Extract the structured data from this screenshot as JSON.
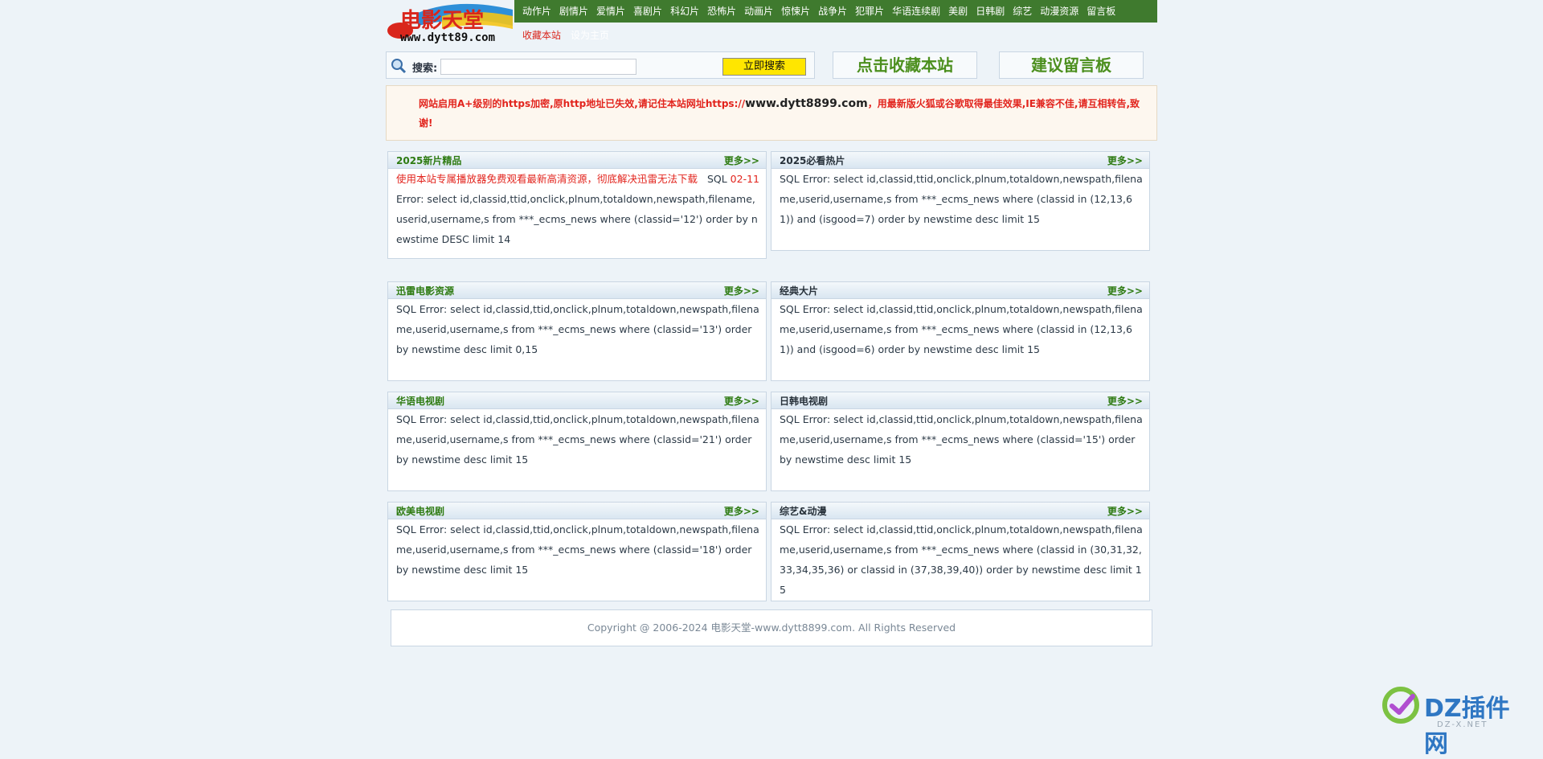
{
  "header": {
    "logo_text": "电影天堂",
    "logo_domain": "www.dytt89.com",
    "nav": [
      "动作片",
      "剧情片",
      "爱情片",
      "喜剧片",
      "科幻片",
      "恐怖片",
      "动画片",
      "惊悚片",
      "战争片",
      "犯罪片",
      "华语连续剧",
      "美剧",
      "日韩剧",
      "综艺",
      "动漫资源",
      "留言板"
    ],
    "sub_links": {
      "favorite": "收藏本站",
      "homepage": "设为主页"
    }
  },
  "search": {
    "label": "搜索:",
    "input_value": "",
    "button": "立即搜索"
  },
  "big_links": {
    "bookmark": "点击收藏本站",
    "guestbook": "建议留言板"
  },
  "notice": {
    "text_before": "网站启用A+级别的https加密,原http地址已失效,请记住本站网址https://",
    "url": "www.dytt8899.com",
    "text_after": "，用最新版火狐或谷歌取得最佳效果,IE兼容不佳,请互相转告,致谢!"
  },
  "panels": [
    {
      "title": "2025新片精品",
      "more": "更多>>",
      "promo": "使用本站专属播放器免费观看最新高清资源，彻底解决迅雷无法下载",
      "date": "02-11",
      "body": "SQL Error: select id,classid,ttid,onclick,plnum,totaldown,newspath,filename,userid,username,s from ***_ecms_news where (classid='12') order by newstime DESC limit 14"
    },
    {
      "title": "2025必看热片",
      "more": "更多>>",
      "body": "SQL Error: select id,classid,ttid,onclick,plnum,totaldown,newspath,filename,userid,username,s from ***_ecms_news where (classid in (12,13,61)) and (isgood=7) order by newstime desc limit 15"
    },
    {
      "title": "迅雷电影资源",
      "more": "更多>>",
      "body": "SQL Error: select id,classid,ttid,onclick,plnum,totaldown,newspath,filename,userid,username,s from ***_ecms_news where (classid='13') order by newstime desc limit 0,15"
    },
    {
      "title": "经典大片",
      "more": "更多>>",
      "body": "SQL Error: select id,classid,ttid,onclick,plnum,totaldown,newspath,filename,userid,username,s from ***_ecms_news where (classid in (12,13,61)) and (isgood=6) order by newstime desc limit 15"
    },
    {
      "title": "华语电视剧",
      "more": "更多>>",
      "body": "SQL Error: select id,classid,ttid,onclick,plnum,totaldown,newspath,filename,userid,username,s from ***_ecms_news where (classid='21') order by newstime desc limit 15"
    },
    {
      "title": "日韩电视剧",
      "more": "更多>>",
      "body": "SQL Error: select id,classid,ttid,onclick,plnum,totaldown,newspath,filename,userid,username,s from ***_ecms_news where (classid='15') order by newstime desc limit 15"
    },
    {
      "title": "欧美电视剧",
      "more": "更多>>",
      "body": "SQL Error: select id,classid,ttid,onclick,plnum,totaldown,newspath,filename,userid,username,s from ***_ecms_news where (classid='18') order by newstime desc limit 15"
    },
    {
      "title": "综艺&动漫",
      "more": "更多>>",
      "body": "SQL Error: select id,classid,ttid,onclick,plnum,totaldown,newspath,filename,userid,username,s from ***_ecms_news where (classid in (30,31,32,33,34,35,36) or classid in (37,38,39,40)) order by newstime desc limit 15"
    }
  ],
  "footer": "Copyright @ 2006-2024 电影天堂-www.dytt8899.com. All Rights Reserved",
  "watermark": {
    "text": "DZ插件网",
    "sub": "DZ-X.NET"
  }
}
